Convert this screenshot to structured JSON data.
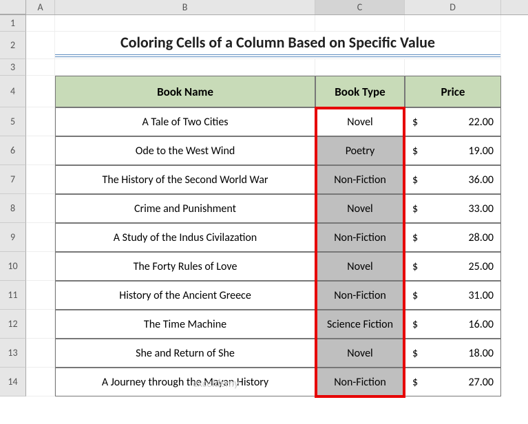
{
  "columns": {
    "A": "A",
    "B": "B",
    "C": "C",
    "D": "D"
  },
  "rowNums": [
    "1",
    "2",
    "3",
    "4",
    "5",
    "6",
    "7",
    "8",
    "9",
    "10",
    "11",
    "12",
    "13",
    "14"
  ],
  "title": "Coloring Cells of a Column Based on Specific Value",
  "headers": {
    "name": "Book Name",
    "type": "Book Type",
    "price": "Price"
  },
  "rows": [
    {
      "name": "A Tale of Two Cities",
      "type": "Novel",
      "price": "22.00",
      "firstNovel": true
    },
    {
      "name": "Ode to the West Wind",
      "type": "Poetry",
      "price": "19.00"
    },
    {
      "name": "The History of the Second World War",
      "type": "Non-Fiction",
      "price": "36.00"
    },
    {
      "name": "Crime and Punishment",
      "type": "Novel",
      "price": "33.00"
    },
    {
      "name": "A Study of the Indus Civilazation",
      "type": "Non-Fiction",
      "price": "28.00"
    },
    {
      "name": "The Forty Rules of Love",
      "type": "Novel",
      "price": "25.00"
    },
    {
      "name": "History of the Ancient Greece",
      "type": "Non-Fiction",
      "price": "31.00"
    },
    {
      "name": "The Time Machine",
      "type": "Science Fiction",
      "price": "16.00"
    },
    {
      "name": "She and Return of She",
      "type": "Novel",
      "price": "18.00"
    },
    {
      "name": "A Journey through the Mayan History",
      "type": "Non-Fiction",
      "price": "27.00"
    }
  ],
  "currency": "$",
  "watermark": "exceldemy"
}
